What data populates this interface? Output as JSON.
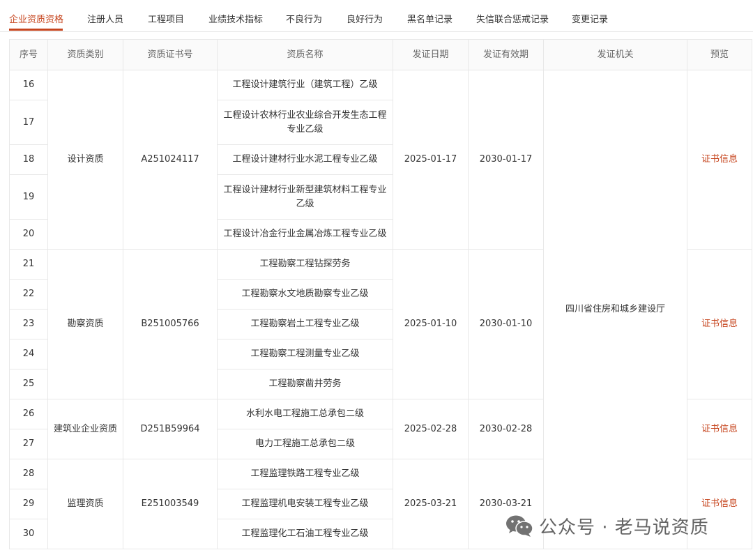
{
  "tabs": [
    {
      "label": "企业资质资格"
    },
    {
      "label": "注册人员"
    },
    {
      "label": "工程项目"
    },
    {
      "label": "业绩技术指标"
    },
    {
      "label": "不良行为"
    },
    {
      "label": "良好行为"
    },
    {
      "label": "黑名单记录"
    },
    {
      "label": "失信联合惩戒记录"
    },
    {
      "label": "变更记录"
    }
  ],
  "table": {
    "headers": [
      "序号",
      "资质类别",
      "资质证书号",
      "资质名称",
      "发证日期",
      "发证有效期",
      "发证机关",
      "预览"
    ],
    "issuer": "四川省住房和城乡建设厅",
    "groups": [
      {
        "category": "设计资质",
        "cert_no": "A251024117",
        "issue_date": "2025-01-17",
        "valid_until": "2030-01-17",
        "preview": "证书信息",
        "rows": [
          {
            "no": "16",
            "name": "工程设计建筑行业（建筑工程）乙级"
          },
          {
            "no": "17",
            "name": "工程设计农林行业农业综合开发生态工程专业乙级"
          },
          {
            "no": "18",
            "name": "工程设计建材行业水泥工程专业乙级"
          },
          {
            "no": "19",
            "name": "工程设计建材行业新型建筑材料工程专业乙级"
          },
          {
            "no": "20",
            "name": "工程设计冶金行业金属冶炼工程专业乙级"
          }
        ]
      },
      {
        "category": "勘察资质",
        "cert_no": "B251005766",
        "issue_date": "2025-01-10",
        "valid_until": "2030-01-10",
        "preview": "证书信息",
        "rows": [
          {
            "no": "21",
            "name": "工程勘察工程钻探劳务"
          },
          {
            "no": "22",
            "name": "工程勘察水文地质勘察专业乙级"
          },
          {
            "no": "23",
            "name": "工程勘察岩土工程专业乙级"
          },
          {
            "no": "24",
            "name": "工程勘察工程测量专业乙级"
          },
          {
            "no": "25",
            "name": "工程勘察凿井劳务"
          }
        ]
      },
      {
        "category": "建筑业企业资质",
        "cert_no": "D251B59964",
        "issue_date": "2025-02-28",
        "valid_until": "2030-02-28",
        "preview": "证书信息",
        "rows": [
          {
            "no": "26",
            "name": "水利水电工程施工总承包二级"
          },
          {
            "no": "27",
            "name": "电力工程施工总承包二级"
          }
        ]
      },
      {
        "category": "监理资质",
        "cert_no": "E251003549",
        "issue_date": "2025-03-21",
        "valid_until": "2030-03-21",
        "preview": "证书信息",
        "rows": [
          {
            "no": "28",
            "name": "工程监理铁路工程专业乙级"
          },
          {
            "no": "29",
            "name": "工程监理机电安装工程专业乙级"
          },
          {
            "no": "30",
            "name": "工程监理化工石油工程专业乙级"
          }
        ]
      }
    ]
  },
  "watermark": {
    "text": "公众号 · 老马说资质",
    "icon": "wechat-icon"
  }
}
